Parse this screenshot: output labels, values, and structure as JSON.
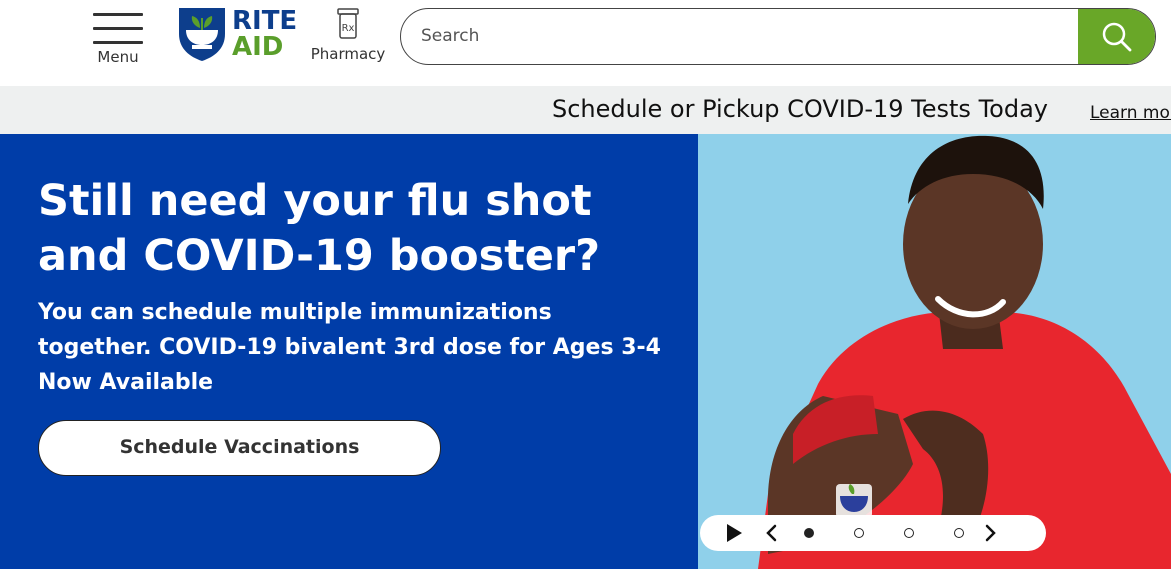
{
  "header": {
    "menu_label": "Menu",
    "logo_line1": "RITE",
    "logo_line2": "AID",
    "pharmacy_label": "Pharmacy",
    "search_placeholder": "Search",
    "search_icon": "search-icon",
    "accent_color": "#69a728"
  },
  "announcement": {
    "text": "Schedule or Pickup COVID-19 Tests Today",
    "link": "Learn more"
  },
  "hero": {
    "title": "Still need your flu shot and COVID-19 booster?",
    "subtitle": "You can schedule multiple immunizations together. COVID-19 bivalent 3rd dose for Ages 3-4 Now Available",
    "button": "Schedule Vaccinations",
    "bg_color": "#003da8"
  },
  "carousel": {
    "slides": 4,
    "active_index": 0,
    "play_icon": "play-icon",
    "prev_icon": "chevron-left-icon",
    "next_icon": "chevron-right-icon"
  }
}
